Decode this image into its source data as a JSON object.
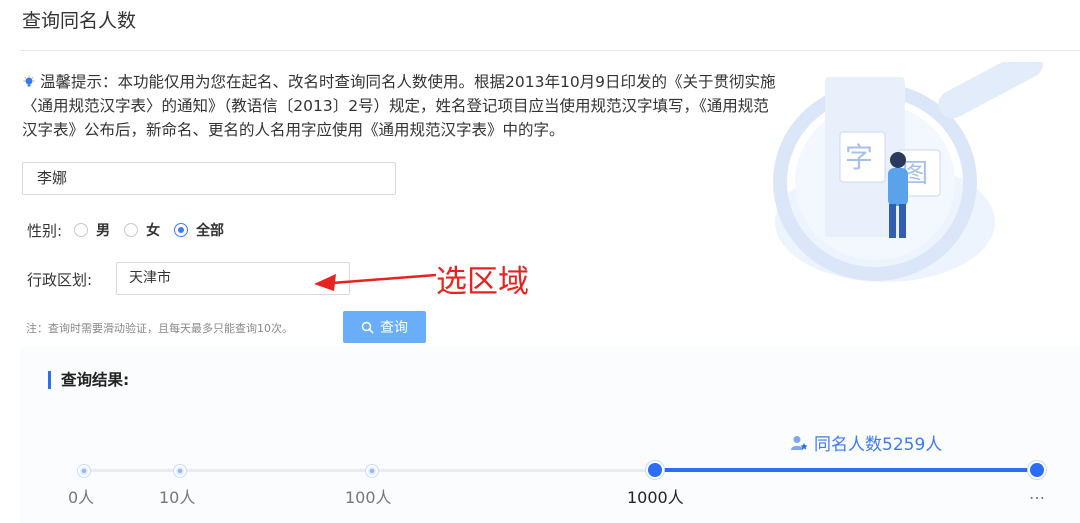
{
  "page": {
    "title": "查询同名人数"
  },
  "tip": {
    "label": "温馨提示：",
    "text": "本功能仅用为您在起名、改名时查询同名人数使用。根据2013年10月9日印发的《关于贯彻实施〈通用规范汉字表〉的通知》（教语信〔2013〕2号）规定，姓名登记项目应当使用规范汉字填写，《通用规范汉字表》公布后，新命名、更名的人名用字应使用《通用规范汉字表》中的字。"
  },
  "form": {
    "name_value": "李娜",
    "gender_label": "性别:",
    "gender_options": [
      "男",
      "女",
      "全部"
    ],
    "gender_selected": "全部",
    "region_label": "行政区划:",
    "region_value": "天津市",
    "note": "注：查询时需要滑动验证，且每天最多只能查询10次。",
    "query_button": "查询"
  },
  "annotation": {
    "text": "选区域",
    "color": "#e8221f"
  },
  "result": {
    "title": "查询结果:",
    "count_label": "同名人数5259人",
    "scale_labels": [
      "0人",
      "10人",
      "100人",
      "1000人",
      "…"
    ],
    "active_label": "1000人",
    "accent_color": "#2c6df5"
  },
  "icons": {
    "tip": "lightbulb-icon",
    "query": "search-icon",
    "count": "person-star-icon"
  }
}
